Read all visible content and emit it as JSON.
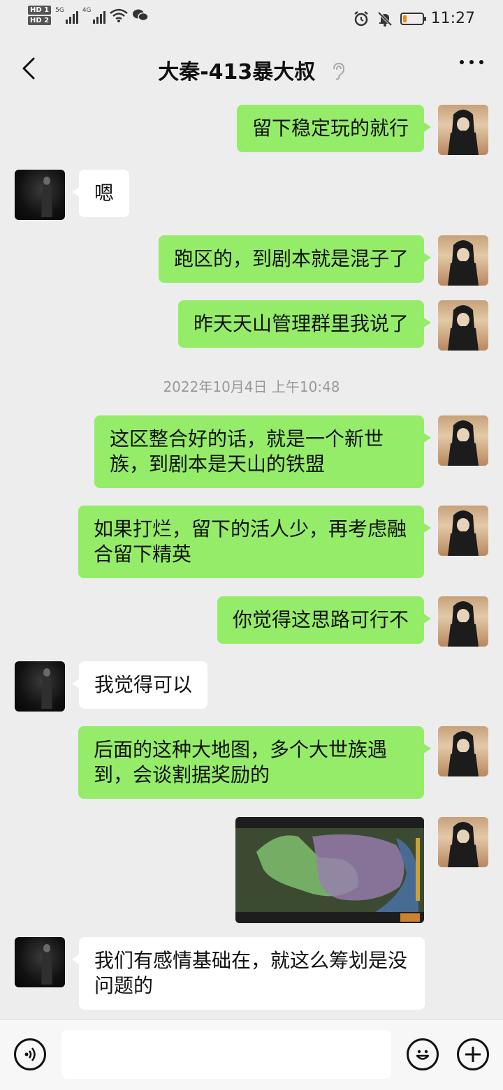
{
  "status_bar": {
    "hd1": "HD 1",
    "hd2": "HD 2",
    "net1": "5G",
    "net2": "4G",
    "time": "11:27",
    "battery_level": 0.2
  },
  "header": {
    "title": "大秦-413暴大叔",
    "back_icon": "chevron-left-icon",
    "more_icon": "more-dots-icon"
  },
  "messages": [
    {
      "side": "me",
      "text": "留下稳定玩的就行"
    },
    {
      "side": "other",
      "text": "嗯"
    },
    {
      "side": "me",
      "text": "跑区的，到剧本就是混子了"
    },
    {
      "side": "me",
      "text": "昨天天山管理群里我说了"
    },
    {
      "timestamp": "2022年10月4日 上午10:48"
    },
    {
      "side": "me",
      "text": "这区整合好的话，就是一个新世族，到剧本是天山的铁盟"
    },
    {
      "side": "me",
      "text": "如果打烂，留下的活人少，再考虑融合留下精英"
    },
    {
      "side": "me",
      "text": "你觉得这思路可行不"
    },
    {
      "side": "other",
      "text": "我觉得可以"
    },
    {
      "side": "me",
      "text": "后面的这种大地图，多个大世族遇到，会谈割据奖励的"
    },
    {
      "side": "me",
      "image": "game-map-screenshot"
    },
    {
      "side": "other",
      "text": "我们有感情基础在，就这么筹划是没问题的"
    }
  ],
  "input_bar": {
    "voice_icon": "voice-icon",
    "emoji_icon": "emoji-icon",
    "plus_icon": "plus-icon"
  },
  "colors": {
    "background": "#ededed",
    "my_bubble": "#95ec69",
    "other_bubble": "#ffffff",
    "battery": "#f08a1c"
  }
}
